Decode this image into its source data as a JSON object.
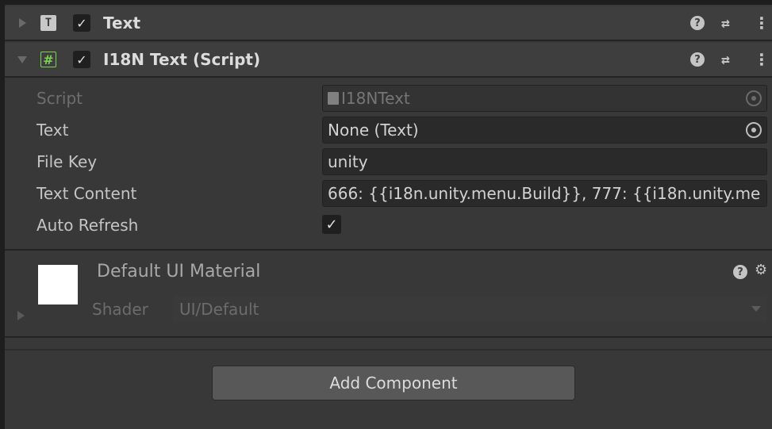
{
  "components": [
    {
      "title": "Text",
      "icon": "text-component-icon",
      "icon_glyph": "T",
      "enabled": true,
      "expanded": false
    },
    {
      "title": "I18N Text (Script)",
      "icon": "script-hash-icon",
      "icon_glyph": "#",
      "enabled": true,
      "expanded": true
    }
  ],
  "header_buttons": {
    "help_glyph": "?",
    "presets_glyph": "⇄",
    "kebab_glyph": "⋮"
  },
  "properties": {
    "script": {
      "label": "Script",
      "value": "I18NText"
    },
    "text": {
      "label": "Text",
      "value": "None (Text)"
    },
    "file_key": {
      "label": "File Key",
      "value": "unity"
    },
    "text_content": {
      "label": "Text Content",
      "value": "666: {{i18n.unity.menu.Build}}, 777:  {{i18n.unity.me"
    },
    "auto_refresh": {
      "label": "Auto Refresh",
      "checked": true
    }
  },
  "material": {
    "title": "Default UI Material",
    "shader_label": "Shader",
    "shader_value": "UI/Default"
  },
  "add_component_label": "Add Component",
  "check_glyph": "✓",
  "colors": {
    "panel": "#383838",
    "header": "#3e3e3e",
    "field": "#2a2a2a",
    "script_green": "#7bd44f",
    "button": "#585858"
  }
}
